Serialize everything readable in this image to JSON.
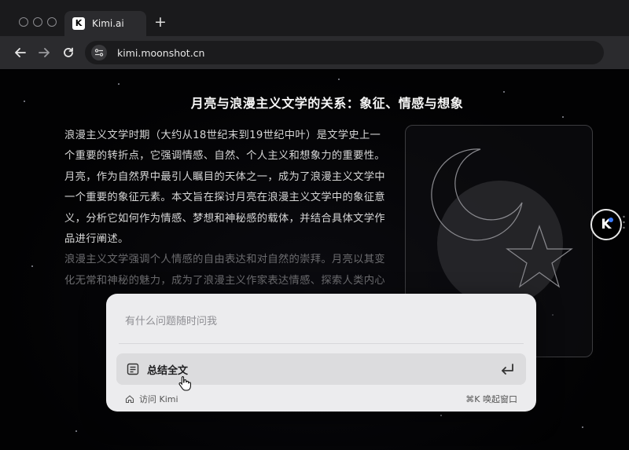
{
  "browser": {
    "tab_title": "Kimi.ai",
    "tab_logo": "K",
    "new_tab": "+",
    "url": "kimi.moonshot.cn",
    "icons": [
      "back-arrow-icon",
      "forward-arrow-icon",
      "reload-icon",
      "site-settings-icon"
    ]
  },
  "article": {
    "title": "月亮与浪漫主义文学的关系：象征、情感与想象",
    "paragraph1": "浪漫主义文学时期（大约从18世纪末到19世纪中叶）是文学史上一个重要的转折点，它强调情感、自然、个人主义和想象力的重要性。月亮，作为自然界中最引人瞩目的天体之一，成为了浪漫主义文学中一个重要的象征元素。本文旨在探讨月亮在浪漫主义文学中的象征意义，分析它如何作为情感、梦想和神秘感的载体，并结合具体文学作品进行阐述。",
    "paragraph2": "浪漫主义文学强调个人情感的自由表达和对自然的崇拜。月亮以其变化无常和神秘的魅力，成为了浪漫主义作家表达情感、探索人类内心"
  },
  "illustration": {
    "icons": [
      "crescent-moon-icon",
      "star-icon"
    ]
  },
  "float_button": {
    "label": "K"
  },
  "assistant": {
    "placeholder": "有什么问题随时问我",
    "summary_label": "总结全文",
    "visit_label": "访问 Kimi",
    "shortcut": "⌘K 唤起窗口"
  },
  "colors": {
    "accent": "#3a7bff",
    "panel_bg": "#ececee",
    "page_bg": "#020203"
  }
}
